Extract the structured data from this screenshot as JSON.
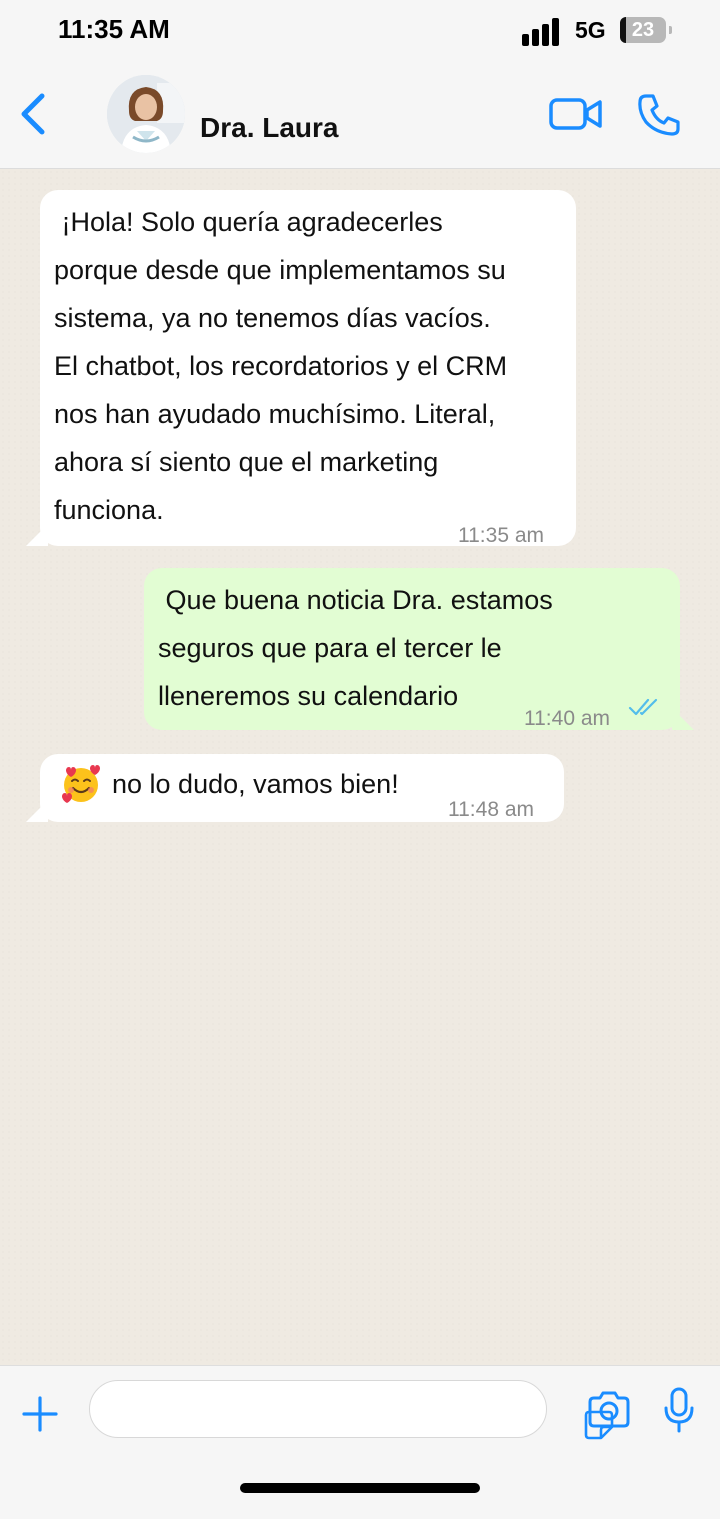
{
  "status": {
    "time": "11:35 AM",
    "network": "5G",
    "battery": "23"
  },
  "header": {
    "contact_name": "Dra. Laura"
  },
  "messages": [
    {
      "direction": "incoming",
      "text": " ¡Hola! Solo quería agradecerles\nporque desde que implementamos su\nsistema, ya no tenemos días vacíos.\nEl chatbot, los recordatorios y el CRM\nnos han ayudado muchísimo. Literal,\nahora sí siento que el marketing\nfunciona.",
      "time": "11:35 am"
    },
    {
      "direction": "outgoing",
      "text": " Que buena noticia Dra. estamos\nseguros que para el tercer le\nlleneremos su calendario",
      "time": "11:40 am",
      "status": "read"
    },
    {
      "direction": "incoming",
      "emoji": "smiling-face-with-hearts",
      "text": "no lo dudo, vamos bien!",
      "time": "11:48 am"
    }
  ],
  "composer": {
    "placeholder": ""
  },
  "colors": {
    "accent": "#1a8cff",
    "outgoing_bubble": "#e2fdd3",
    "incoming_bubble": "#ffffff",
    "chat_bg": "#efeae2",
    "read_ticks": "#53bdeb"
  }
}
